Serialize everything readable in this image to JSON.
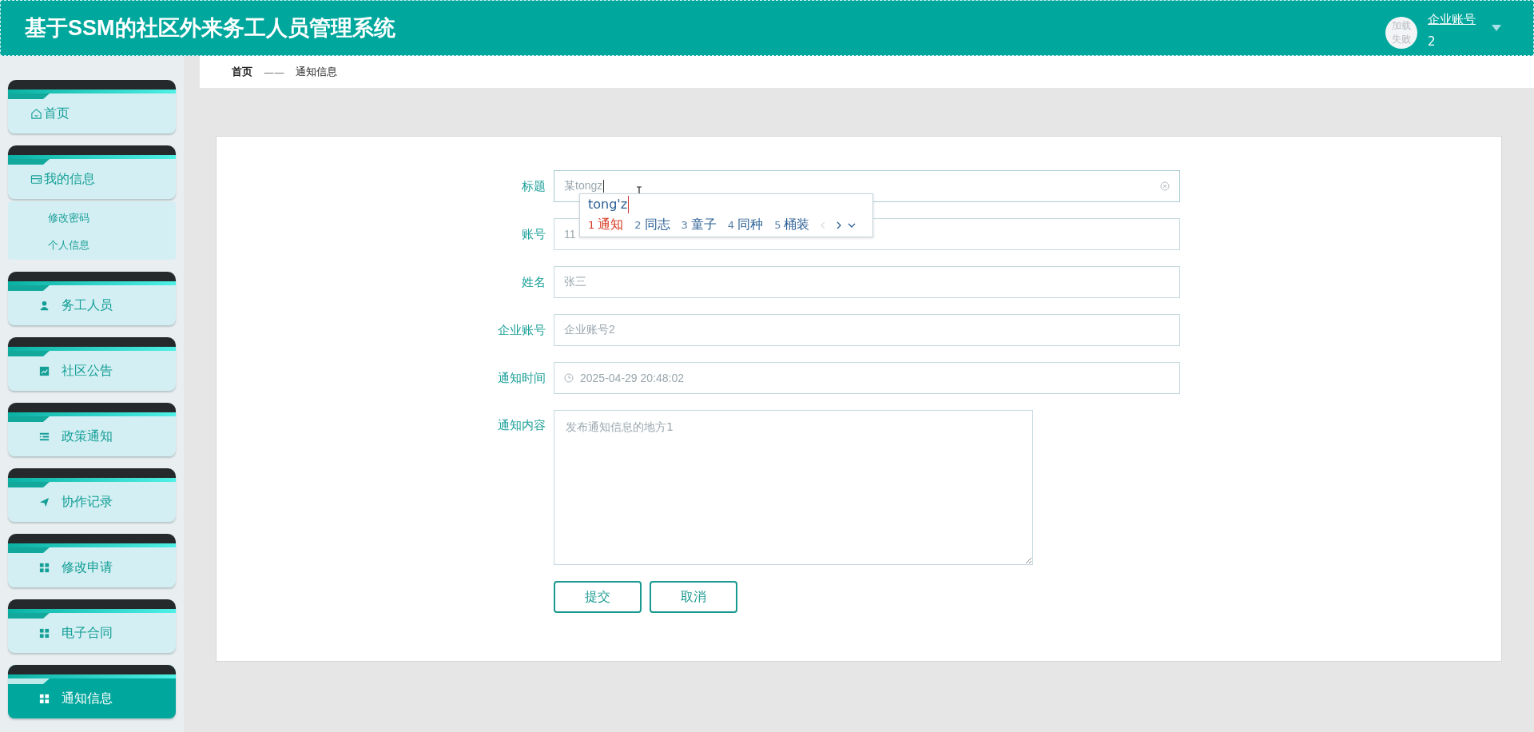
{
  "header": {
    "title": "基于SSM的社区外来务工人员管理系统",
    "avatar_alt": "加载失败",
    "user_role": "企业账号",
    "user_name": "2"
  },
  "sidebar": {
    "items": [
      {
        "kind": "home",
        "label": "首页",
        "selected": false
      },
      {
        "kind": "card",
        "label": "我的信息",
        "selected": false,
        "expanded": true,
        "children": [
          {
            "label": "修改密码"
          },
          {
            "label": "个人信息"
          }
        ]
      },
      {
        "kind": "user",
        "label": "务工人员",
        "selected": false
      },
      {
        "kind": "chart",
        "label": "社区公告",
        "selected": false
      },
      {
        "kind": "list",
        "label": "政策通知",
        "selected": false
      },
      {
        "kind": "send",
        "label": "协作记录",
        "selected": false
      },
      {
        "kind": "grid",
        "label": "修改申请",
        "selected": false
      },
      {
        "kind": "grid",
        "label": "电子合同",
        "selected": false
      },
      {
        "kind": "grid",
        "label": "通知信息",
        "selected": true
      }
    ]
  },
  "breadcrumb": [
    {
      "label": "首页"
    },
    {
      "label": "——"
    },
    {
      "label": "通知信息"
    }
  ],
  "form": {
    "fields": [
      {
        "kind": "text",
        "label": "标题",
        "value": "某tongz",
        "clearable": true,
        "focused": true
      },
      {
        "kind": "text",
        "label": "账号",
        "value": "11"
      },
      {
        "kind": "text",
        "label": "姓名",
        "value": "张三"
      },
      {
        "kind": "text",
        "label": "企业账号",
        "value": "企业账号2"
      },
      {
        "kind": "datetime",
        "label": "通知时间",
        "value": "2025-04-29 20:48:02"
      },
      {
        "kind": "textarea",
        "label": "通知内容",
        "value": "发布通知信息的地方1"
      }
    ],
    "buttons": [
      {
        "label": "提交"
      },
      {
        "label": "取消"
      }
    ]
  },
  "ime": {
    "composition": "tong'z",
    "candidates": [
      {
        "index": "1",
        "text": "通知",
        "selected": true
      },
      {
        "index": "2",
        "text": "同志",
        "selected": false
      },
      {
        "index": "3",
        "text": "童子",
        "selected": false
      },
      {
        "index": "4",
        "text": "同种",
        "selected": false
      },
      {
        "index": "5",
        "text": "桶装",
        "selected": false
      }
    ],
    "prev_disabled": true
  }
}
